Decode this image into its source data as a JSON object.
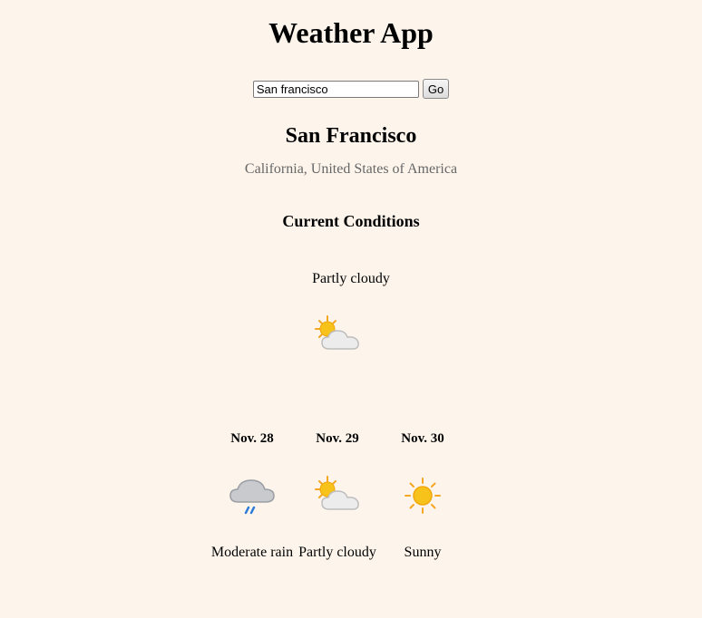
{
  "app": {
    "title": "Weather App"
  },
  "search": {
    "value": "San francisco",
    "button_label": "Go"
  },
  "location": {
    "city": "San Francisco",
    "region": "California, United States of America"
  },
  "current": {
    "heading": "Current Conditions",
    "condition": "Partly cloudy",
    "icon": "partly-cloudy-icon"
  },
  "forecast": [
    {
      "date": "Nov. 28",
      "condition": "Moderate rain",
      "icon": "rain-cloud-icon"
    },
    {
      "date": "Nov. 29",
      "condition": "Partly cloudy",
      "icon": "partly-cloudy-icon"
    },
    {
      "date": "Nov. 30",
      "condition": "Sunny",
      "icon": "sun-icon"
    }
  ],
  "colors": {
    "background": "#fdf5ec",
    "sun": "#f7c21a",
    "sun_ray": "#f5a623",
    "cloud": "#e6e6e6",
    "rain_cloud": "#b5b8bd",
    "rain": "#2f7bd8",
    "region_text": "#666666"
  }
}
